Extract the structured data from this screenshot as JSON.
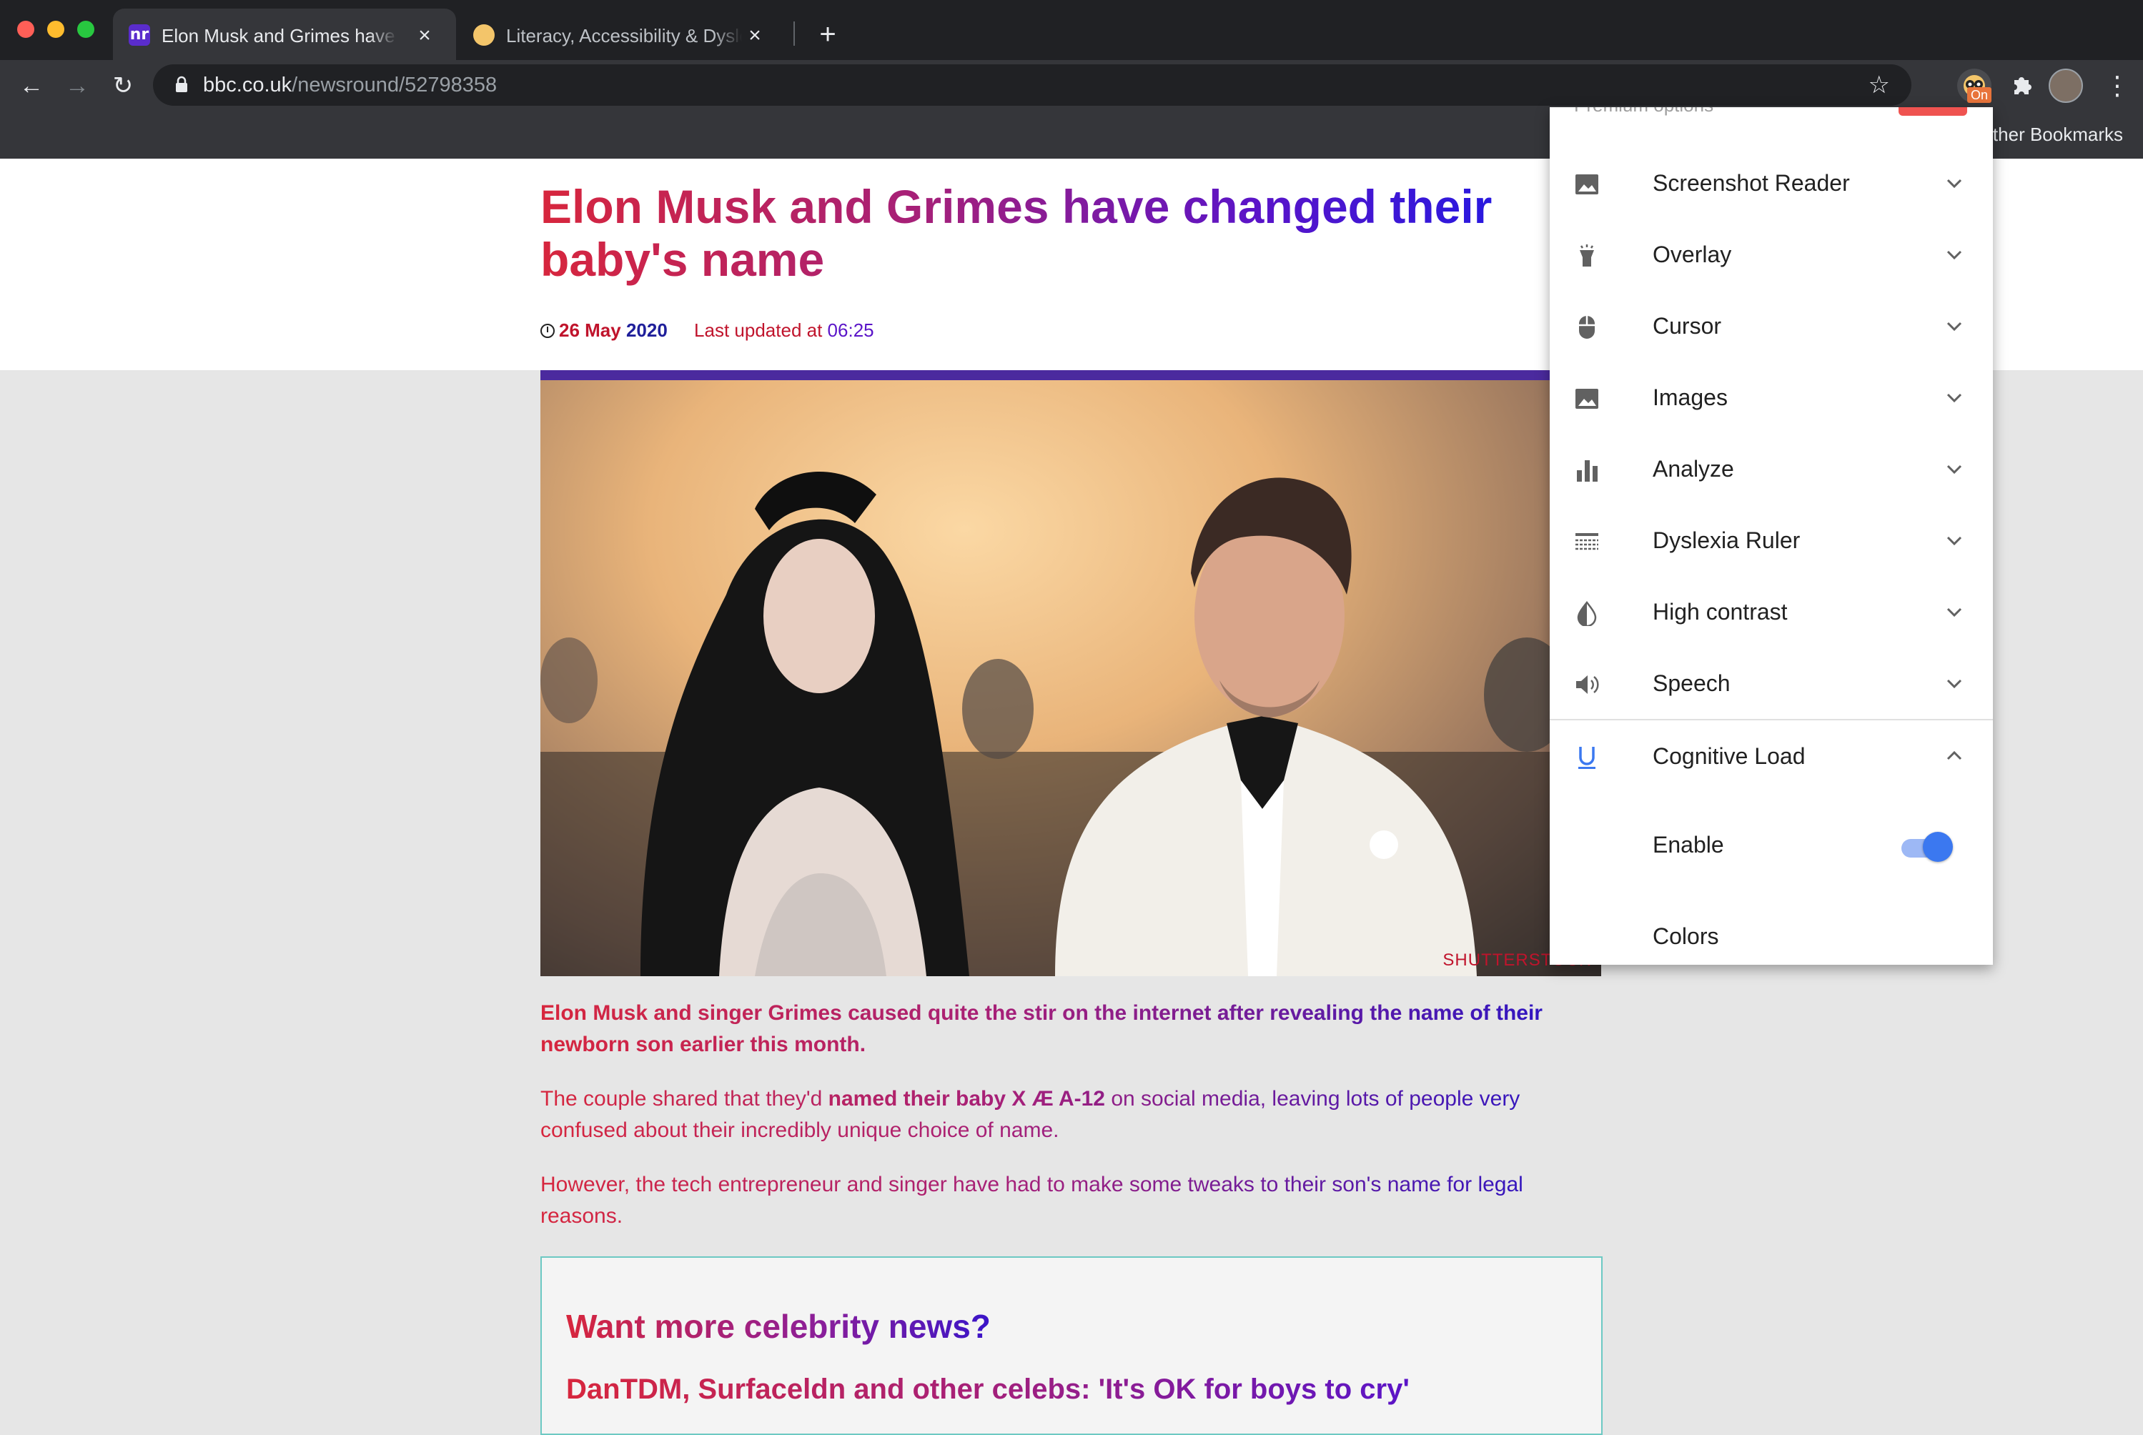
{
  "browser": {
    "tabs": [
      {
        "title": "Elon Musk and Grimes have changed their baby's name",
        "favicon": "nr",
        "active": true
      },
      {
        "title": "Literacy, Accessibility & Dyslexia",
        "active": false
      }
    ],
    "url_domain": "bbc.co.uk",
    "url_path": "/newsround/52798358",
    "extension_badge": "On",
    "bookmarks_other": "Other Bookmarks"
  },
  "article": {
    "headline": "Elon Musk and Grimes have changed their baby's name",
    "date_day": "26 May",
    "date_year": "2020",
    "updated_label": "Last updated at",
    "updated_time": "06:25",
    "image_credit": "SHUTTERSTOCK",
    "lede": "Elon Musk and singer Grimes caused quite the stir on the internet after revealing the name of their newborn son earlier this month.",
    "p1_before": "The couple shared that they'd ",
    "p1_bold": "named their baby X Æ A-12",
    "p1_after": " on social media, leaving lots of people very confused about their incredibly unique choice of name.",
    "p2": "However, the tech entrepreneur and singer have had to make some tweaks to their son's name for legal reasons.",
    "promo_title": "Want more celebrity news?",
    "promo_link": "DanTDM, Surfaceldn and other celebs: 'It's OK for boys to cry'"
  },
  "panel": {
    "peek_label": "Premium options",
    "items": [
      {
        "label": "Screenshot Reader",
        "icon": "image-icon"
      },
      {
        "label": "Overlay",
        "icon": "flashlight-icon"
      },
      {
        "label": "Cursor",
        "icon": "mouse-icon"
      },
      {
        "label": "Images",
        "icon": "image-icon"
      },
      {
        "label": "Analyze",
        "icon": "bar-chart-icon"
      },
      {
        "label": "Dyslexia Ruler",
        "icon": "ruler-icon"
      },
      {
        "label": "High contrast",
        "icon": "contrast-icon"
      },
      {
        "label": "Speech",
        "icon": "speaker-icon"
      },
      {
        "label": "Cognitive Load",
        "icon": "underline-icon",
        "expanded": true
      }
    ],
    "cognitive_enable_label": "Enable",
    "cognitive_enable_on": true,
    "cognitive_colors_label": "Colors",
    "accent_color": "#3b78f0"
  }
}
